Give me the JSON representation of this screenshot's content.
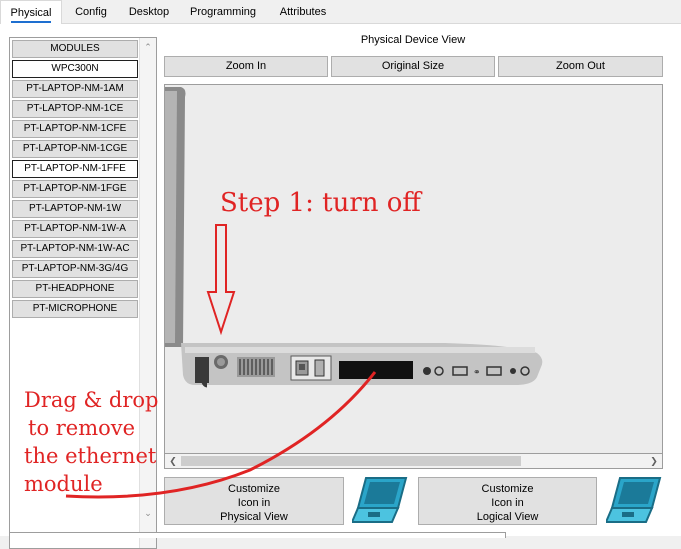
{
  "tabs": [
    {
      "label": "Physical",
      "active": true
    },
    {
      "label": "Config",
      "active": false
    },
    {
      "label": "Desktop",
      "active": false
    },
    {
      "label": "Programming",
      "active": false
    },
    {
      "label": "Attributes",
      "active": false
    }
  ],
  "modules": {
    "header": "MODULES",
    "items": [
      "WPC300N",
      "PT-LAPTOP-NM-1AM",
      "PT-LAPTOP-NM-1CE",
      "PT-LAPTOP-NM-1CFE",
      "PT-LAPTOP-NM-1CGE",
      "PT-LAPTOP-NM-1FFE",
      "PT-LAPTOP-NM-1FGE",
      "PT-LAPTOP-NM-1W",
      "PT-LAPTOP-NM-1W-A",
      "PT-LAPTOP-NM-1W-AC",
      "PT-LAPTOP-NM-3G/4G",
      "PT-HEADPHONE",
      "PT-MICROPHONE"
    ]
  },
  "device_view": {
    "title": "Physical Device View",
    "zoom_in": "Zoom In",
    "original_size": "Original Size",
    "zoom_out": "Zoom Out"
  },
  "customize_physical": {
    "line1": "Customize",
    "line2": "Icon in",
    "line3": "Physical View"
  },
  "customize_logical": {
    "line1": "Customize",
    "line2": "Icon in",
    "line3": "Logical View"
  },
  "annotations": {
    "step1": "Step 1: turn off",
    "drag1": "Drag & drop",
    "drag2": "to remove",
    "drag3": "the ethernet",
    "drag4": "module"
  },
  "colors": {
    "annotation_red": "#e02424",
    "tab_accent": "#1e6fd0",
    "laptop_icon": "#2aa5c9"
  }
}
